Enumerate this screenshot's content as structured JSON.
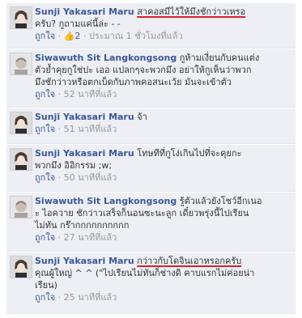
{
  "colors": {
    "link": "#3b5998",
    "bg": "#edeff4",
    "underline": "#d8222b"
  },
  "comments": [
    {
      "author": "Sunji Yakasari Maru",
      "line1": "สาคอสมีไว้ให้มึงชักว่าวเหรอ",
      "line2": "ครับ? กูถามแค่นี้ล่ะ - -",
      "like": "ถูกใจ",
      "sep": " · ",
      "likes_icon": "thumbs-up-icon",
      "likes": "2",
      "time": " · ประมาณ 1 ชั่วโมงที่แล้ว"
    },
    {
      "author": "Siwawuth Sit Langkongsong",
      "line1": "กูห้ามเงี่ยนกับคนแต่ง",
      "line2": "ตัวย้ำคุยกูใช่ปะ เออ แปลกๆจะพวกมึง อย่าให้กูเห็นว่าพวก",
      "line3": "มึงชักว่าวหรือตกเบ็ดกับภาพคอสนะเว้ย มันจะเข้าตัว",
      "like": "ถูกใจ",
      "sep": " · ",
      "time": "52 นาทีที่แล้ว"
    },
    {
      "author": "Sunji Yakasari Maru",
      "line1": "จ้า",
      "like": "ถูกใจ",
      "sep": " · ",
      "time": "51 นาทีที่แล้ว"
    },
    {
      "author": "Sunji Yakasari Maru",
      "line1": "โทษทีที่กูโง่เกินไปที่จะคุยกะ",
      "line2": "พวกมึง อิอิกรรม ;w;",
      "like": "ถูกใจ",
      "sep": " · ",
      "time": "50 นาทีที่แล้ว"
    },
    {
      "author": "Siwawuth Sit Langkongsong",
      "line1": "รู้ตัวแล้วยังโชว์อีกเนอ",
      "line2": "ะ ไอควาย ชักว่าวเสร็จก็นอนซะนะลูก เดี๋ยวพรุ่งนี้ไปเรียน",
      "line3": "ไม่ทัน กร๊ากกกกกกกกกก",
      "like": "ถูกใจ",
      "sep": " · ",
      "time": "27 นาทีที่แล้ว"
    },
    {
      "author": "Sunji Yakasari Maru",
      "line1": "กว่าวกับโดจินเอาหรอกครับ",
      "line2": "คุณผู้ใหญ่ ^ ^ (\"ไปเรียนไม่ทันก็ช่างดิ คาบแรกไม่ค่อยน่า",
      "line3": "เรียน)",
      "like": "ถูกใจ",
      "sep": " · ",
      "time": "25 นาทีที่แล้ว"
    }
  ]
}
